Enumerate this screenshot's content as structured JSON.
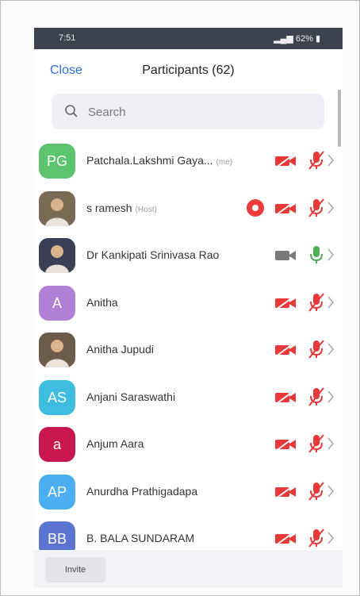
{
  "status_bar": {
    "time": "7:51",
    "battery": "62%"
  },
  "header": {
    "close_label": "Close",
    "title": "Participants (62)"
  },
  "search": {
    "placeholder": "Search"
  },
  "participants": [
    {
      "initials": "PG",
      "name": "Patchala.Lakshmi Gaya...",
      "tag": "(me)",
      "avatar_color": "#5cc36f",
      "avatar_type": "initials",
      "video": "off",
      "audio": "muted",
      "recording": false
    },
    {
      "initials": "",
      "name": "s ramesh",
      "tag": "(Host)",
      "avatar_color": "#7a6a55",
      "avatar_type": "photo",
      "video": "off",
      "audio": "muted",
      "recording": true
    },
    {
      "initials": "",
      "name": "Dr Kankipati Srinivasa Rao",
      "tag": "",
      "avatar_color": "#3b3f55",
      "avatar_type": "photo",
      "video": "on",
      "audio": "on",
      "recording": false
    },
    {
      "initials": "A",
      "name": "Anitha",
      "tag": "",
      "avatar_color": "#b07fd6",
      "avatar_type": "initials",
      "video": "off",
      "audio": "muted",
      "recording": false
    },
    {
      "initials": "",
      "name": "Anitha Jupudi",
      "tag": "",
      "avatar_color": "#6c5a4a",
      "avatar_type": "photo",
      "video": "off",
      "audio": "muted",
      "recording": false
    },
    {
      "initials": "AS",
      "name": "Anjani Saraswathi",
      "tag": "",
      "avatar_color": "#3fbde0",
      "avatar_type": "initials",
      "video": "off",
      "audio": "muted",
      "recording": false
    },
    {
      "initials": "a",
      "name": "Anjum Aara",
      "tag": "",
      "avatar_color": "#c8184f",
      "avatar_type": "initials",
      "video": "off",
      "audio": "muted",
      "recording": false
    },
    {
      "initials": "AP",
      "name": "Anurdha Prathigadapa",
      "tag": "",
      "avatar_color": "#4aaef0",
      "avatar_type": "initials",
      "video": "off",
      "audio": "muted",
      "recording": false
    },
    {
      "initials": "BB",
      "name": "B. BALA SUNDARAM",
      "tag": "",
      "avatar_color": "#5a74d0",
      "avatar_type": "initials",
      "video": "off",
      "audio": "muted",
      "recording": false
    }
  ],
  "footer": {
    "invite_label": "Invite"
  },
  "colors": {
    "accent": "#2d6fd6",
    "muted_red": "#e8383a",
    "video_on_gray": "#7a7a7a",
    "mic_on_green": "#4caf50"
  }
}
